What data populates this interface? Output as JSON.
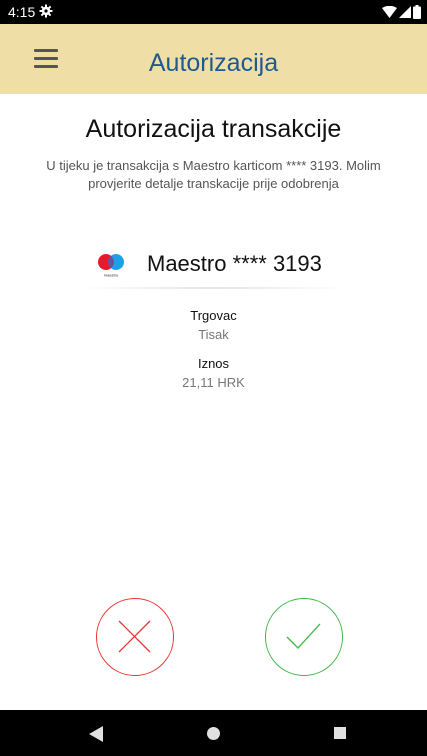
{
  "status_bar": {
    "time": "4:15",
    "icons": [
      "gear-icon",
      "wifi-icon",
      "signal-icon",
      "battery-icon"
    ]
  },
  "app_bar": {
    "menu_icon": "hamburger-menu-icon",
    "title": "Autorizacija",
    "background": "#efdfa7",
    "title_color": "#1e5a8e"
  },
  "content": {
    "page_title": "Autorizacija transakcije",
    "description": "U tijeku je transakcija s Maestro karticom **** 3193. Molim provjerite detalje transkacije prije odobrenja",
    "card": {
      "brand_logo": "maestro-logo-icon",
      "logo_text": "maestro",
      "name": "Maestro **** 3193"
    },
    "details": [
      {
        "label": "Trgovac",
        "value": "Tisak"
      },
      {
        "label": "Iznos",
        "value": "21,11 HRK"
      }
    ]
  },
  "actions": {
    "reject_icon": "x-icon",
    "approve_icon": "checkmark-icon",
    "reject_color": "#e53935",
    "approve_color": "#43b84a"
  },
  "nav_bar": {
    "icons": [
      "back-triangle-icon",
      "home-circle-icon",
      "recents-square-icon"
    ]
  }
}
